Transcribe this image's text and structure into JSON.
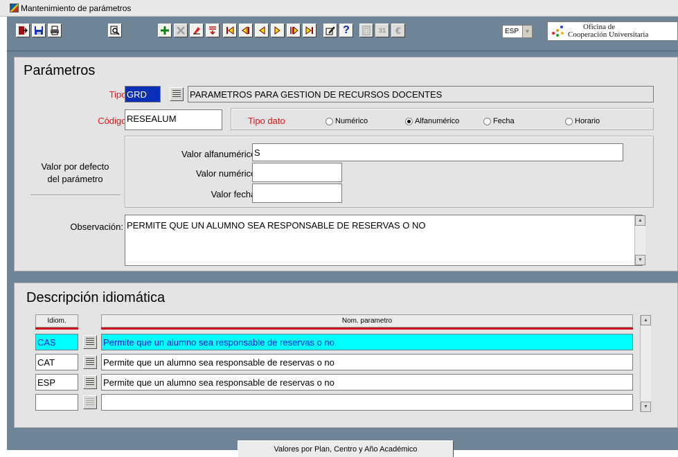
{
  "window": {
    "title": "Mantenimiento de parámetros"
  },
  "toolbar": {
    "language": "ESP",
    "logo": {
      "line1": "Oficina de",
      "line2": "Cooperación Universitaria"
    }
  },
  "parametros": {
    "title": "Parámetros",
    "tipo_label": "Tipo:",
    "tipo_value": "GRD",
    "tipo_desc": "PARAMETROS PARA GESTION DE RECURSOS DOCENTES",
    "codigo_label": "Código:",
    "codigo_value": "RESEALUM",
    "tipo_dato_label": "Tipo dato",
    "tipo_dato_options": [
      "Numérico",
      "Alfanumérico",
      "Fecha",
      "Horario"
    ],
    "tipo_dato_selected": "Alfanumérico",
    "valor_defecto_label_1": "Valor por defecto",
    "valor_defecto_label_2": "del parámetro",
    "valor_alfa_label": "Valor alfanumérico:",
    "valor_alfa_value": "S",
    "valor_num_label": "Valor numérico:",
    "valor_num_value": "",
    "valor_fecha_label": "Valor fecha:",
    "valor_fecha_value": "",
    "observacion_label": "Observación:",
    "observacion_value": "PERMITE QUE UN ALUMNO SEA RESPONSABLE DE RESERVAS O NO"
  },
  "descripcion": {
    "title": "Descripción idiomática",
    "col_idiom": "Idiom.",
    "col_nom": "Nom. parametro",
    "rows": [
      {
        "idiom": "CAS",
        "nom": "Permite que un alumno sea responsable de reservas o no"
      },
      {
        "idiom": "CAT",
        "nom": "Permite que un alumno sea responsable de reservas o no"
      },
      {
        "idiom": "ESP",
        "nom": "Permite que un alumno sea responsable de reservas o no"
      },
      {
        "idiom": "",
        "nom": ""
      }
    ]
  },
  "bottom_button": "Valores por Plan, Centro y Año Académico"
}
